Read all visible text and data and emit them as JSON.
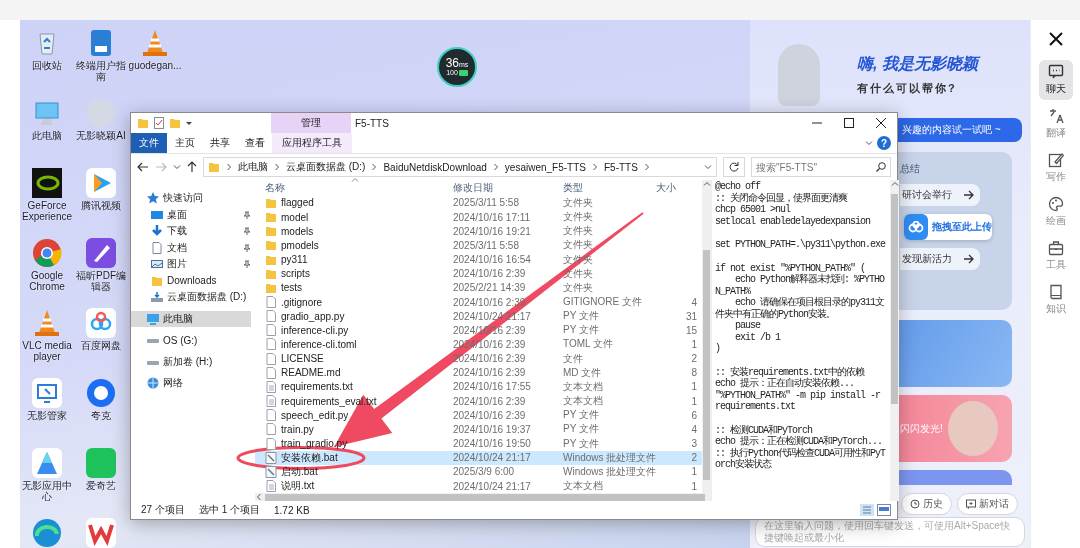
{
  "desktop": {
    "columns": [
      [
        {
          "kind": "recycle-bin",
          "label": "回收站"
        },
        {
          "kind": "monitor",
          "label": "此电脑"
        },
        {
          "kind": "eye-logo",
          "label": "GeForce Experience"
        },
        {
          "kind": "ring-logo",
          "label": "Google Chrome"
        },
        {
          "kind": "cone",
          "label": "VLC media player"
        },
        {
          "kind": "monitor-tool",
          "label": "无影管家"
        },
        {
          "kind": "triangle-logo",
          "label": "无影应用中心"
        },
        {
          "kind": "swirl-logo"
        }
      ],
      [
        {
          "kind": "book",
          "label": "终端用户指南"
        },
        {
          "kind": "avatar",
          "label": "无影晓颖AI"
        },
        {
          "kind": "play",
          "label": "腾讯视频"
        },
        {
          "kind": "pen",
          "label": "福昕PDF编辑器"
        },
        {
          "kind": "rings",
          "label": "百度网盘"
        },
        {
          "kind": "circle-logo",
          "label": "夸克"
        },
        {
          "kind": "green-tile",
          "label": "爱奇艺"
        },
        {
          "kind": "zigzag-logo"
        }
      ],
      [
        {
          "kind": "cone",
          "label": "guodegan..."
        }
      ]
    ]
  },
  "network_widget": {
    "latency": "36",
    "unit": "ms",
    "battery": "100"
  },
  "explorer": {
    "title": "F5-TTS",
    "context_tab": "管理",
    "help": "?",
    "ribbon_tabs": [
      {
        "label": "文件",
        "kind": "file"
      },
      {
        "label": "主页",
        "kind": "tab"
      },
      {
        "label": "共享",
        "kind": "tab"
      },
      {
        "label": "查看",
        "kind": "tab"
      },
      {
        "label": "应用程序工具",
        "kind": "context"
      }
    ],
    "path": [
      "此电脑",
      "云桌面数据盘 (D:)",
      "BaiduNetdiskDownload",
      "yesaiwen_F5-TTS",
      "F5-TTS"
    ],
    "search": {
      "placeholder": "搜索\"F5-TTS\""
    },
    "nav": [
      {
        "label": "快速访问",
        "kind": "star",
        "selected": false,
        "children": [
          {
            "label": "桌面",
            "kind": "desktop",
            "selected": false,
            "pinned": true
          },
          {
            "label": "下载",
            "kind": "download",
            "selected": false,
            "pinned": true
          },
          {
            "label": "文档",
            "kind": "document",
            "selected": false,
            "pinned": true
          },
          {
            "label": "图片",
            "kind": "picture",
            "selected": false,
            "pinned": true
          },
          {
            "label": "Downloads",
            "kind": "folder",
            "selected": false,
            "pinned": false
          },
          {
            "label": "云桌面数据盘 (D:)",
            "kind": "cloud-drive",
            "selected": false,
            "pinned": false
          }
        ]
      },
      {
        "label": "此电脑",
        "kind": "pc",
        "selected": true
      },
      {
        "label": "OS (G:)",
        "kind": "drive",
        "selected": false
      },
      {
        "label": "新加卷 (H:)",
        "kind": "drive",
        "selected": false
      },
      {
        "label": "网络",
        "kind": "network",
        "selected": false
      }
    ],
    "columns": [
      "名称",
      "修改日期",
      "类型",
      "大小"
    ],
    "rows": [
      {
        "name": "flagged",
        "kind": "folder",
        "date": "2025/3/11 5:58",
        "type": "文件夹",
        "selected": false
      },
      {
        "name": "model",
        "kind": "folder",
        "date": "2024/10/16 17:11",
        "type": "文件夹",
        "selected": false
      },
      {
        "name": "models",
        "kind": "folder",
        "date": "2024/10/16 19:21",
        "type": "文件夹",
        "selected": false
      },
      {
        "name": "pmodels",
        "kind": "folder",
        "date": "2025/3/11 5:58",
        "type": "文件夹",
        "selected": false
      },
      {
        "name": "py311",
        "kind": "folder",
        "date": "2024/10/16 16:54",
        "type": "文件夹",
        "selected": false
      },
      {
        "name": "scripts",
        "kind": "folder",
        "date": "2024/10/16 2:39",
        "type": "文件夹",
        "selected": false
      },
      {
        "name": "tests",
        "kind": "folder",
        "date": "2025/2/21 14:39",
        "type": "文件夹",
        "selected": false
      },
      {
        "name": ".gitignore",
        "kind": "file",
        "date": "2024/10/16 2:39",
        "type": "GITIGNORE 文件",
        "size": "4",
        "selected": false
      },
      {
        "name": "gradio_app.py",
        "kind": "file",
        "date": "2024/10/24 21:17",
        "type": "PY 文件",
        "size": "31",
        "selected": false
      },
      {
        "name": "inference-cli.py",
        "kind": "file",
        "date": "2024/10/16 2:39",
        "type": "PY 文件",
        "size": "15",
        "selected": false
      },
      {
        "name": "inference-cli.toml",
        "kind": "file",
        "date": "2024/10/16 2:39",
        "type": "TOML 文件",
        "size": "1",
        "selected": false
      },
      {
        "name": "LICENSE",
        "kind": "file",
        "date": "2024/10/16 2:39",
        "type": "文件",
        "size": "2",
        "selected": false
      },
      {
        "name": "README.md",
        "kind": "file",
        "date": "2024/10/16 2:39",
        "type": "MD 文件",
        "size": "8",
        "selected": false
      },
      {
        "name": "requirements.txt",
        "kind": "text",
        "date": "2024/10/16 17:55",
        "type": "文本文档",
        "size": "1",
        "selected": false
      },
      {
        "name": "requirements_eval.txt",
        "kind": "text",
        "date": "2024/10/16 2:39",
        "type": "文本文档",
        "size": "1",
        "selected": false
      },
      {
        "name": "speech_edit.py",
        "kind": "file",
        "date": "2024/10/16 2:39",
        "type": "PY 文件",
        "size": "6",
        "selected": false
      },
      {
        "name": "train.py",
        "kind": "file",
        "date": "2024/10/16 19:37",
        "type": "PY 文件",
        "size": "4",
        "selected": false
      },
      {
        "name": "train_gradio.py",
        "kind": "file",
        "date": "2024/10/16 19:50",
        "type": "PY 文件",
        "size": "3",
        "selected": false
      },
      {
        "name": "安装依赖.bat",
        "kind": "script",
        "date": "2024/10/24 21:17",
        "type": "Windows 批处理文件",
        "size": "2",
        "selected": true
      },
      {
        "name": "启动.bat",
        "kind": "script",
        "date": "2025/3/9 6:00",
        "type": "Windows 批处理文件",
        "size": "1",
        "selected": false
      },
      {
        "name": "说明.txt",
        "kind": "text",
        "date": "2024/10/24 21:17",
        "type": "文本文档",
        "size": "1",
        "selected": false
      }
    ],
    "preview": {
      "blocks": [
        [
          "@echo off",
          ":: 关闭命令回显，使界面更清爽",
          "chcp 65001 >nul",
          "setlocal enabledelayedexpansion"
        ],
        [
          "set PYTHON_PATH=.\\py311\\python.exe"
        ],
        [
          "if not exist \"%PYTHON_PATH%\" (",
          "    echo Python解释器未找到: %PYTHON_PATH%",
          "    echo 请确保在项目根目录的py311文件夹中有正确的Python安装。",
          "    pause",
          "    exit /b 1",
          ")"
        ],
        [
          ":: 安装requirements.txt中的依赖",
          "echo 提示：正在自动安装依赖...",
          "\"%PYTHON_PATH%\" -m pip install -r requirements.txt"
        ],
        [
          ":: 检测CUDA和PyTorch",
          "echo 提示：正在检测CUDA和PyTorch...",
          ":: 执行Python代码检查CUDA可用性和PyTorch安装状态"
        ]
      ]
    },
    "status": {
      "count": "27 个项目",
      "selection": "选中 1 个项目",
      "size": "1.72 KB"
    }
  },
  "assistant": {
    "greeting": "嗨, 我是无影晓颖",
    "subtitle": "有什么可以帮你?",
    "banner": "兴趣的内容试一试吧 ~",
    "card_title": "总结",
    "suggestions": [
      "研讨会举行",
      "发现新活力"
    ],
    "upload_tip": "拖拽至此上传",
    "promo_text": "闪闪发光!",
    "actions": [
      {
        "label": "历史",
        "kind": "history"
      },
      {
        "label": "新对话",
        "kind": "new"
      }
    ],
    "input": {
      "placeholder": "在这里输入问题，使用回车键发送，可使用Alt+Space快捷键唤起或最小化"
    }
  },
  "rail": {
    "items": [
      {
        "label": "聊天",
        "kind": "chat",
        "selected": true
      },
      {
        "label": "翻译",
        "kind": "translate",
        "selected": false
      },
      {
        "label": "写作",
        "kind": "write",
        "selected": false
      },
      {
        "label": "绘画",
        "kind": "paint",
        "selected": false
      },
      {
        "label": "工具",
        "kind": "tools",
        "selected": false
      },
      {
        "label": "知识",
        "kind": "book",
        "selected": false
      }
    ]
  }
}
